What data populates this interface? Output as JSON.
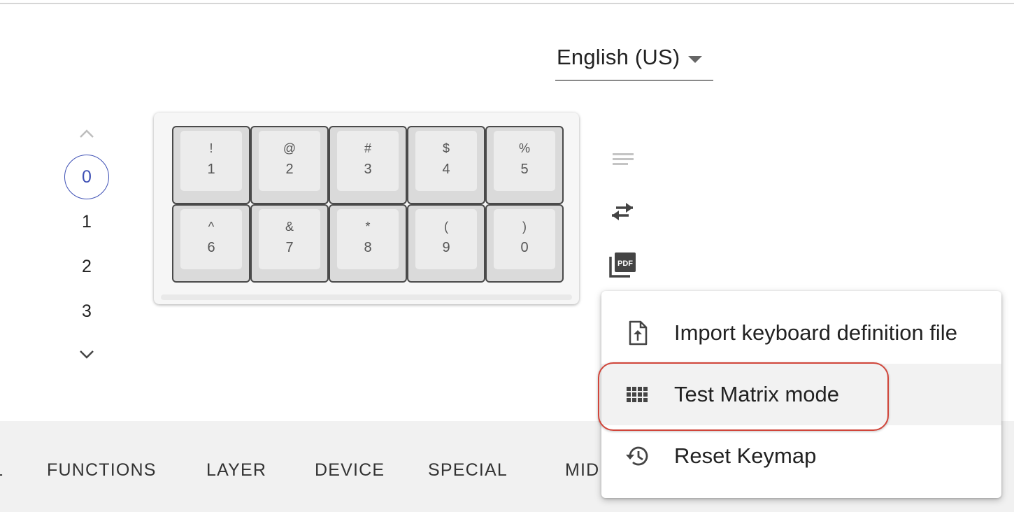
{
  "language_select": {
    "value": "English (US)"
  },
  "layers": {
    "items": [
      "0",
      "1",
      "2",
      "3"
    ],
    "selected": "0"
  },
  "keyboard": {
    "rows": [
      [
        {
          "shift": "!",
          "main": "1"
        },
        {
          "shift": "@",
          "main": "2"
        },
        {
          "shift": "#",
          "main": "3"
        },
        {
          "shift": "$",
          "main": "4"
        },
        {
          "shift": "%",
          "main": "5"
        }
      ],
      [
        {
          "shift": "^",
          "main": "6"
        },
        {
          "shift": "&",
          "main": "7"
        },
        {
          "shift": "*",
          "main": "8"
        },
        {
          "shift": "(",
          "main": "9"
        },
        {
          "shift": ")",
          "main": "0"
        }
      ]
    ]
  },
  "side_icons": [
    "notes-icon",
    "swap-horiz-icon",
    "pdf-icon"
  ],
  "tabs": [
    {
      "label": "L"
    },
    {
      "label": "FUNCTIONS"
    },
    {
      "label": "LAYER"
    },
    {
      "label": "DEVICE"
    },
    {
      "label": "SPECIAL"
    },
    {
      "label": "MID"
    }
  ],
  "menu": {
    "items": [
      {
        "label": "Import keyboard definition file",
        "icon": "upload-file-icon"
      },
      {
        "label": "Test Matrix mode",
        "icon": "grid-icon"
      },
      {
        "label": "Reset Keymap",
        "icon": "history-icon"
      }
    ],
    "highlighted_index": 1
  },
  "colors": {
    "accent": "#3f51b5",
    "highlight_ring": "#d0453a",
    "tabbar_bg": "#f1f1f1"
  }
}
